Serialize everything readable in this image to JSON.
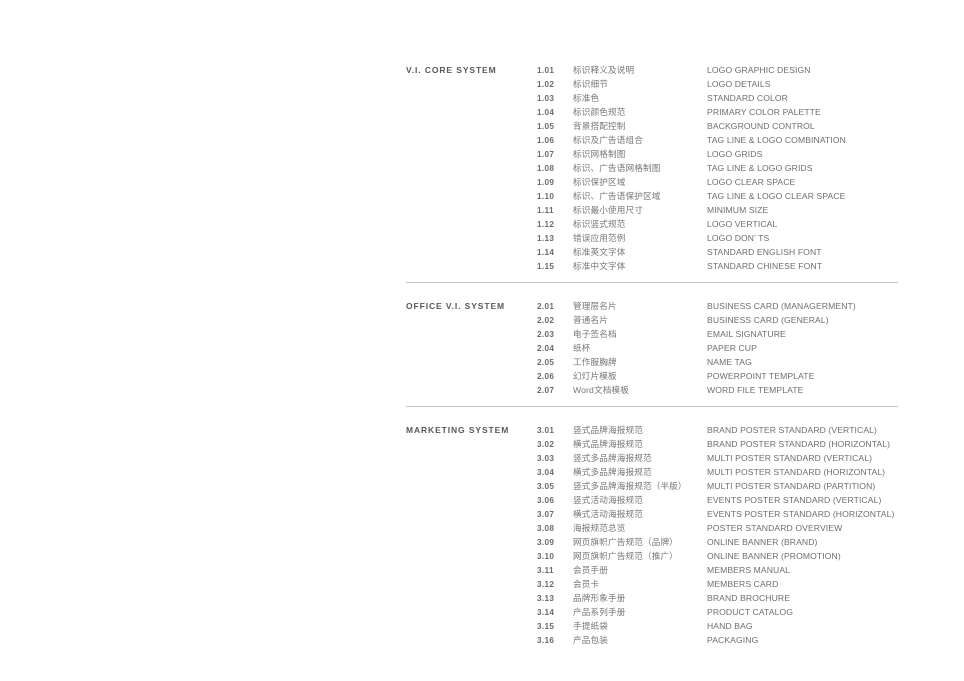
{
  "document": {
    "title": "Brand Guidelines Table of Contents",
    "text_color_heading": "#595959",
    "text_color_number": "#6b6b6b",
    "text_color_chinese": "#777777",
    "text_color_english": "#6e6e6e",
    "divider_color": "#c4c4c4",
    "background": "#ffffff"
  },
  "sections": [
    {
      "title": "V.I. CORE SYSTEM",
      "items": [
        {
          "num": "1.01",
          "cn": "标识释义及说明",
          "en": "LOGO GRAPHIC DESIGN"
        },
        {
          "num": "1.02",
          "cn": "标识细节",
          "en": "LOGO DETAILS"
        },
        {
          "num": "1.03",
          "cn": "标准色",
          "en": "STANDARD COLOR"
        },
        {
          "num": "1.04",
          "cn": "标识颜色规范",
          "en": "PRIMARY COLOR PALETTE"
        },
        {
          "num": "1.05",
          "cn": "背景搭配控制",
          "en": "BACKGROUND CONTROL"
        },
        {
          "num": "1.06",
          "cn": "标识及广告语组合",
          "en": "TAG LINE & LOGO COMBINATION"
        },
        {
          "num": "1.07",
          "cn": "标识网格制图",
          "en": "LOGO GRIDS"
        },
        {
          "num": "1.08",
          "cn": "标识、广告语网格制图",
          "en": "TAG LINE & LOGO GRIDS"
        },
        {
          "num": "1.09",
          "cn": "标识保护区域",
          "en": "LOGO CLEAR SPACE"
        },
        {
          "num": "1.10",
          "cn": "标识、广告语保护区域",
          "en": "TAG LINE & LOGO CLEAR SPACE"
        },
        {
          "num": "1.11",
          "cn": "标识最小使用尺寸",
          "en": "MINIMUM SIZE"
        },
        {
          "num": "1.12",
          "cn": "标识竖式规范",
          "en": "LOGO VERTICAL"
        },
        {
          "num": "1.13",
          "cn": "错误应用范例",
          "en": "LOGO DON’ TS"
        },
        {
          "num": "1.14",
          "cn": "标准英文字体",
          "en": "STANDARD ENGLISH FONT"
        },
        {
          "num": "1.15",
          "cn": "标准中文字体",
          "en": "STANDARD CHINESE FONT"
        }
      ]
    },
    {
      "title": "OFFICE V.I. SYSTEM",
      "items": [
        {
          "num": "2.01",
          "cn": "管理层名片",
          "en": "BUSINESS CARD (MANAGERMENT)"
        },
        {
          "num": "2.02",
          "cn": "普通名片",
          "en": "BUSINESS CARD (GENERAL)"
        },
        {
          "num": "2.03",
          "cn": "电子签名档",
          "en": "EMAIL SIGNATURE"
        },
        {
          "num": "2.04",
          "cn": "纸杯",
          "en": "PAPER CUP"
        },
        {
          "num": "2.05",
          "cn": "工作服胸牌",
          "en": "NAME TAG"
        },
        {
          "num": "2.06",
          "cn": "幻灯片模板",
          "en": "POWERPOINT TEMPLATE"
        },
        {
          "num": "2.07",
          "cn": "Word文档模板",
          "en": "WORD FILE TEMPLATE"
        }
      ]
    },
    {
      "title": "MARKETING SYSTEM",
      "items": [
        {
          "num": "3.01",
          "cn": "竖式品牌海报规范",
          "en": "BRAND POSTER STANDARD (VERTICAL)"
        },
        {
          "num": "3.02",
          "cn": "横式品牌海报规范",
          "en": "BRAND POSTER STANDARD (HORIZONTAL)"
        },
        {
          "num": "3.03",
          "cn": "竖式多品牌海报规范",
          "en": "MULTI POSTER STANDARD (VERTICAL)"
        },
        {
          "num": "3.04",
          "cn": "横式多品牌海报规范",
          "en": "MULTI POSTER STANDARD  (HORIZONTAL)"
        },
        {
          "num": "3.05",
          "cn": "竖式多品牌海报规范（半版）",
          "en": "MULTI POSTER STANDARD (PARTITION)"
        },
        {
          "num": "3.06",
          "cn": "竖式活动海报规范",
          "en": "EVENTS POSTER STANDARD (VERTICAL)"
        },
        {
          "num": "3.07",
          "cn": "横式活动海报规范",
          "en": "EVENTS POSTER STANDARD (HORIZONTAL)"
        },
        {
          "num": "3.08",
          "cn": "海报规范总览",
          "en": "POSTER STANDARD OVERVIEW"
        },
        {
          "num": "3.09",
          "cn": "网页旗帜广告规范（品牌）",
          "en": "ONLINE BANNER (BRAND)"
        },
        {
          "num": "3.10",
          "cn": "网页旗帜广告规范（推广）",
          "en": "ONLINE BANNER (PROMOTION)"
        },
        {
          "num": "3.11",
          "cn": "会员手册",
          "en": "MEMBERS MANUAL"
        },
        {
          "num": "3.12",
          "cn": "会员卡",
          "en": "MEMBERS CARD"
        },
        {
          "num": "3.13",
          "cn": "品牌形象手册",
          "en": "BRAND BROCHURE"
        },
        {
          "num": "3.14",
          "cn": "产品系列手册",
          "en": "PRODUCT CATALOG"
        },
        {
          "num": "3.15",
          "cn": "手提纸袋",
          "en": "HAND BAG"
        },
        {
          "num": "3.16",
          "cn": "产品包装",
          "en": "PACKAGING"
        }
      ]
    }
  ]
}
